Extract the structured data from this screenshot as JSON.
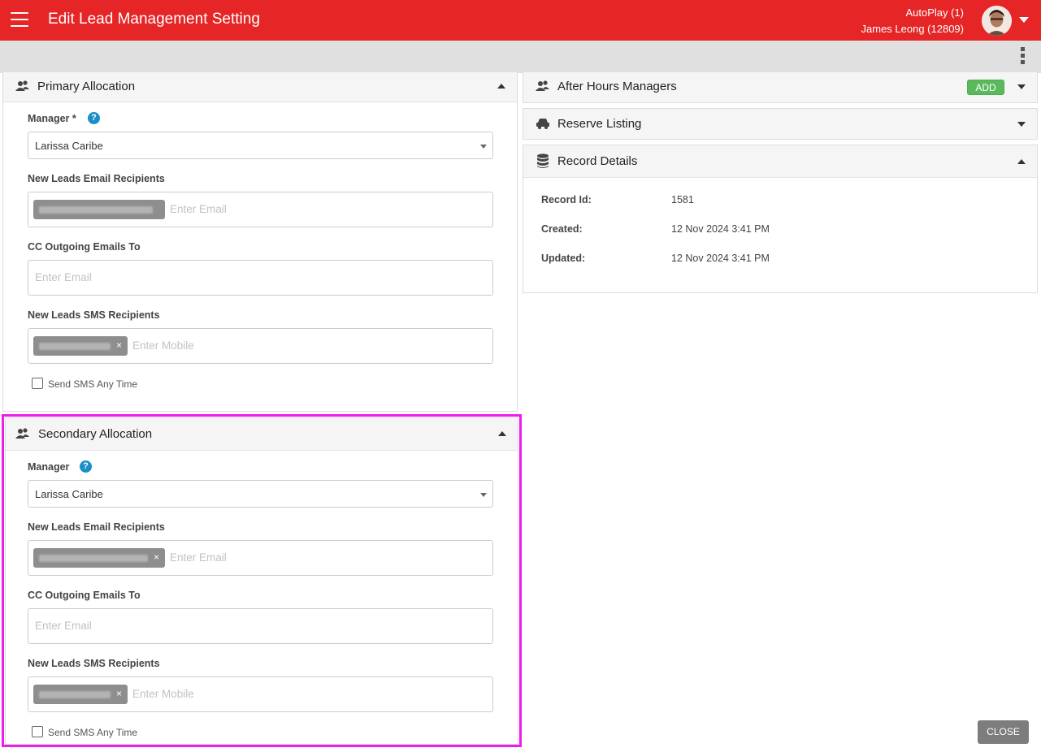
{
  "topbar": {
    "title": "Edit Lead Management Setting",
    "account": "AutoPlay (1)",
    "user": "James Leong (12809)",
    "color": "#e52526"
  },
  "primary": {
    "title": "Primary Allocation",
    "manager_label": "Manager *",
    "manager_value": "Larissa Caribe",
    "email_label": "New Leads Email Recipients",
    "email_placeholder": "Enter Email",
    "cc_label": "CC Outgoing Emails To",
    "cc_placeholder": "Enter Email",
    "sms_label": "New Leads SMS Recipients",
    "sms_placeholder": "Enter Mobile",
    "sms_anytime_label": "Send SMS Any Time"
  },
  "secondary": {
    "title": "Secondary Allocation",
    "manager_label": "Manager",
    "manager_value": "Larissa Caribe",
    "email_label": "New Leads Email Recipients",
    "email_placeholder": "Enter Email",
    "cc_label": "CC Outgoing Emails To",
    "cc_placeholder": "Enter Email",
    "sms_label": "New Leads SMS Recipients",
    "sms_placeholder": "Enter Mobile",
    "sms_anytime_label": "Send SMS Any Time"
  },
  "after_hours": {
    "title": "After Hours Managers",
    "add_label": "ADD"
  },
  "reserve": {
    "title": "Reserve Listing"
  },
  "record": {
    "title": "Record Details",
    "rows": [
      {
        "label": "Record Id:",
        "value": "1581"
      },
      {
        "label": "Created:",
        "value": "12 Nov 2024 3:41 PM"
      },
      {
        "label": "Updated:",
        "value": "12 Nov 2024 3:41 PM"
      }
    ]
  },
  "tag_remove": "×",
  "help_glyph": "?",
  "close_label": "CLOSE",
  "highlight_color": "#ee1bea"
}
